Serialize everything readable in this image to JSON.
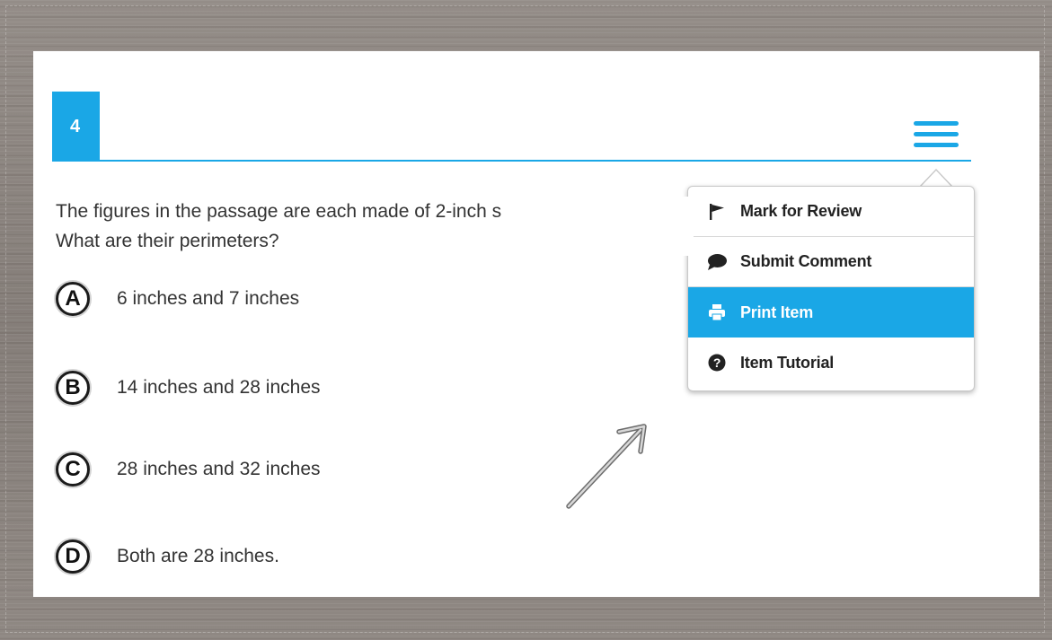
{
  "question": {
    "number": "4",
    "text_line1": "The figures in the passage are each made of 2-inch s",
    "text_line2": "What are their perimeters?"
  },
  "options": [
    {
      "letter": "A",
      "text": "6 inches and 7 inches"
    },
    {
      "letter": "B",
      "text": "14 inches and 28 inches"
    },
    {
      "letter": "C",
      "text": "28 inches and 32 inches"
    },
    {
      "letter": "D",
      "text": "Both are 28 inches."
    }
  ],
  "menu": {
    "items": [
      {
        "label": "Mark for Review",
        "icon": "flag-icon",
        "selected": false
      },
      {
        "label": "Submit Comment",
        "icon": "comment-icon",
        "selected": false
      },
      {
        "label": "Print Item",
        "icon": "printer-icon",
        "selected": true
      },
      {
        "label": "Item Tutorial",
        "icon": "help-icon",
        "selected": false
      }
    ]
  },
  "colors": {
    "accent": "#1aa7e6",
    "text": "#333333",
    "background": "#8c8580"
  }
}
